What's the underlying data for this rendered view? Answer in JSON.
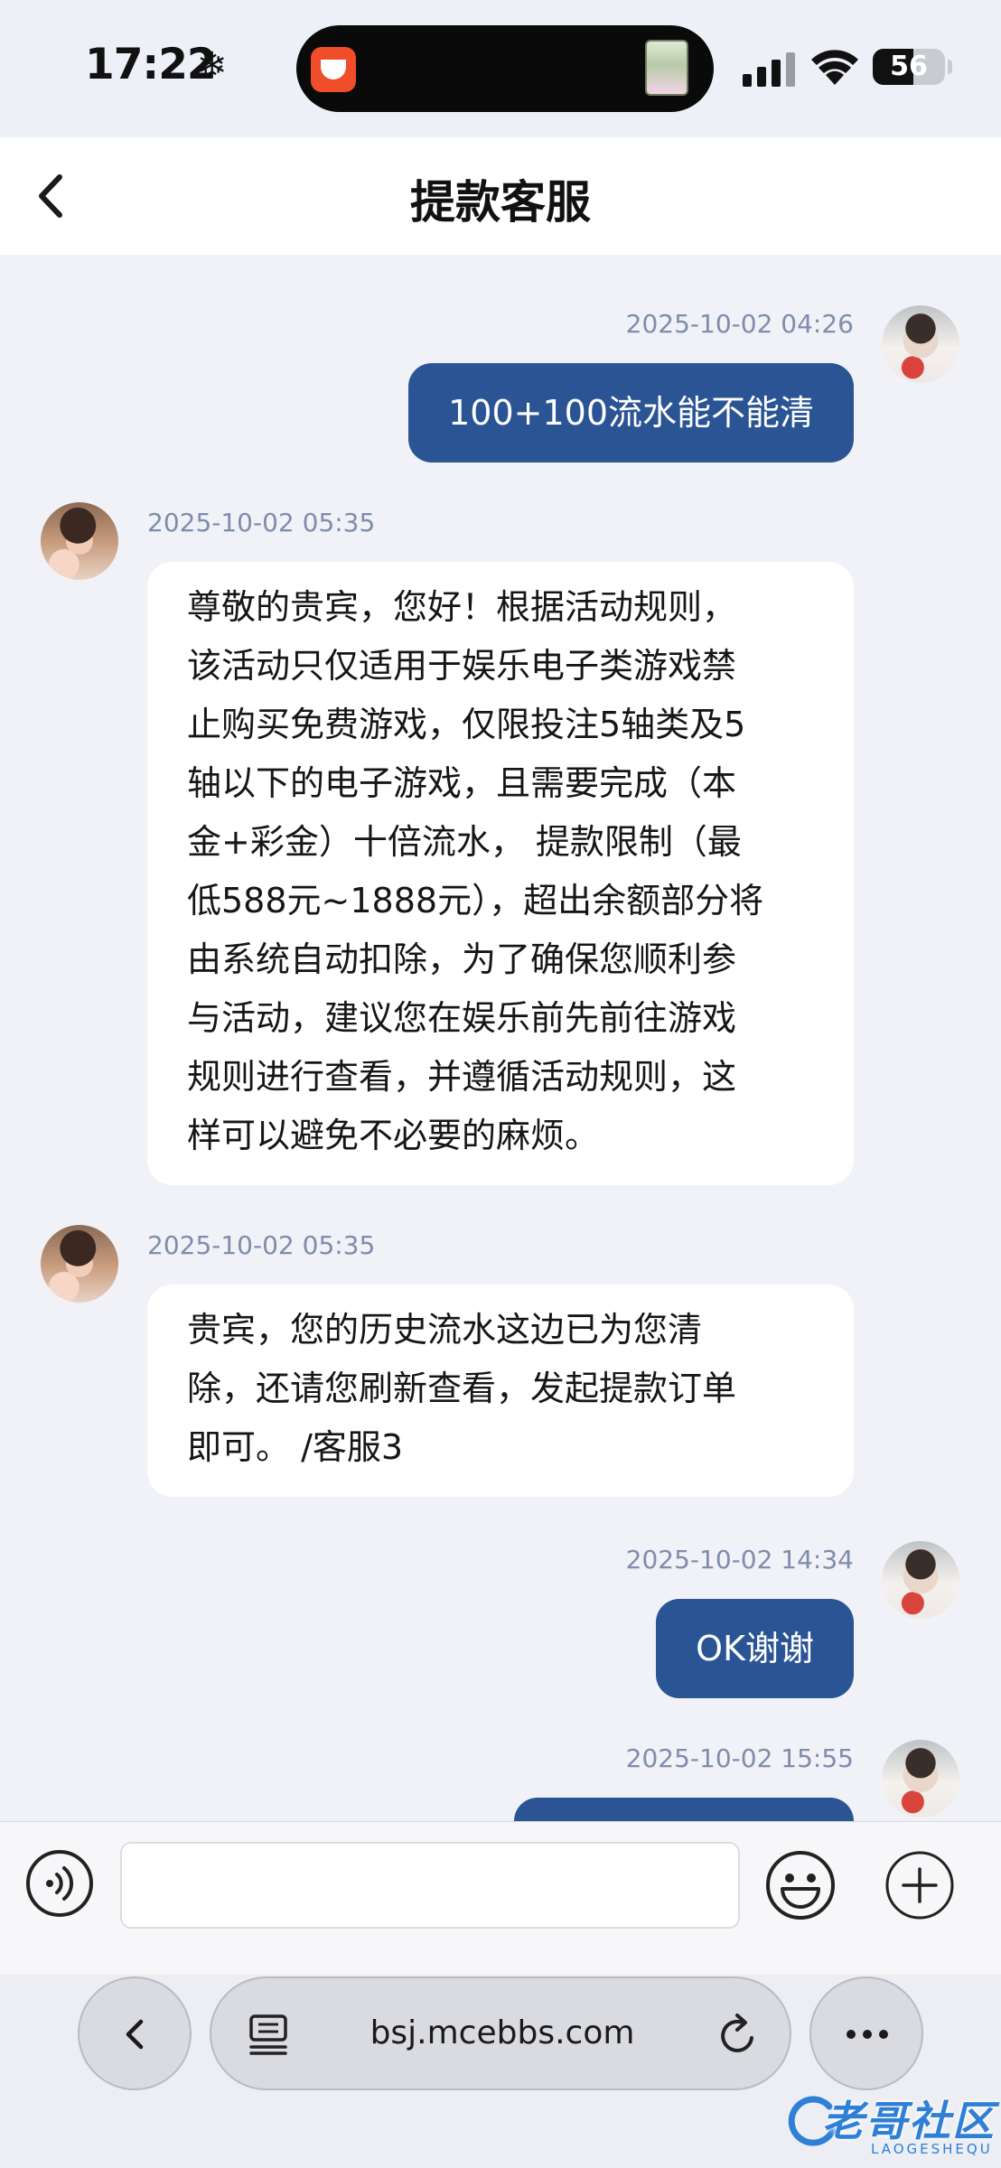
{
  "status_bar": {
    "time": "17:22",
    "battery": "56",
    "battery_level_percent": 56
  },
  "header": {
    "title": "提款客服"
  },
  "messages": [
    {
      "side": "out",
      "timestamp": "2025-10-02 04:26",
      "text": "100+100流水能不能清"
    },
    {
      "side": "in",
      "timestamp": "2025-10-02 05:35",
      "lines": [
        "尊敬的贵宾，您好！根据活动规则，",
        "该活动只仅适用于娱乐电子类游戏禁",
        "止购买免费游戏，仅限投注5轴类及5",
        "轴以下的电子游戏，且需要完成（本",
        "金+彩金）十倍流水， 提款限制（最",
        "低588元~1888元），超出余额部分将",
        "由系统自动扣除，为了确保您顺利参",
        "与活动，建议您在娱乐前先前往游戏",
        "规则进行查看，并遵循活动规则，这",
        "样可以避免不必要的麻烦。"
      ]
    },
    {
      "side": "in",
      "timestamp": "2025-10-02 05:35",
      "lines": [
        "贵宾，您的历史流水这边已为您清",
        "除，还请您刷新查看，发起提款订单",
        "即可。 /客服3"
      ]
    },
    {
      "side": "out",
      "timestamp": "2025-10-02 14:34",
      "text": "OK谢谢"
    },
    {
      "side": "out",
      "timestamp": "2025-10-02 15:55",
      "text": ""
    }
  ],
  "input": {
    "value": "",
    "placeholder": ""
  },
  "browser": {
    "url": "bsj.mcebbs.com"
  },
  "watermark": {
    "text": "老哥社区",
    "sub": "LAOGESHEQU"
  },
  "colors": {
    "outgoing_bubble": "#2a5494",
    "incoming_bubble": "#ffffff",
    "chat_background": "#f1f2f7",
    "timestamp": "#7f8cab"
  },
  "icons": [
    "snowflake-icon",
    "back-chevron-icon",
    "voice-icon",
    "emoji-icon",
    "plus-icon",
    "reader-icon",
    "reload-icon",
    "more-icon"
  ]
}
